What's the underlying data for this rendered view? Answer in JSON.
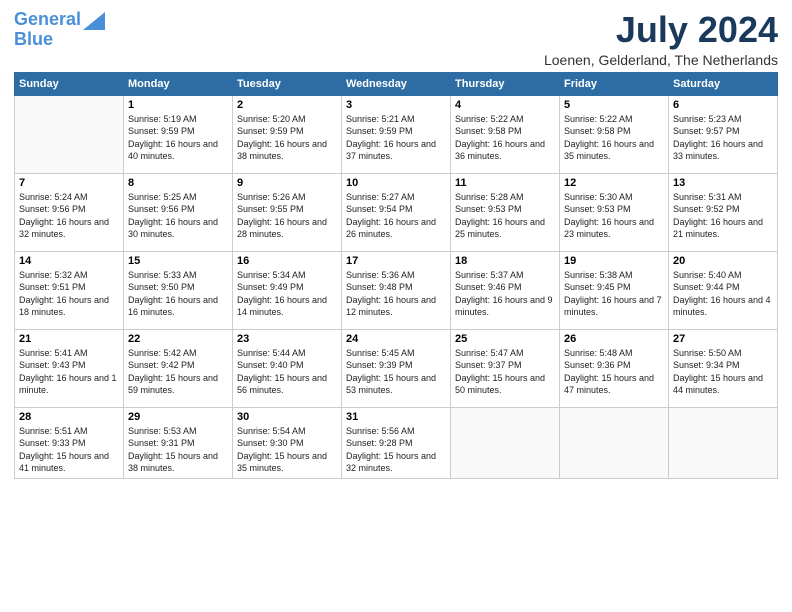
{
  "logo": {
    "line1": "General",
    "line2": "Blue"
  },
  "title": "July 2024",
  "location": "Loenen, Gelderland, The Netherlands",
  "days_of_week": [
    "Sunday",
    "Monday",
    "Tuesday",
    "Wednesday",
    "Thursday",
    "Friday",
    "Saturday"
  ],
  "weeks": [
    [
      {
        "num": "",
        "info": ""
      },
      {
        "num": "1",
        "info": "Sunrise: 5:19 AM\nSunset: 9:59 PM\nDaylight: 16 hours\nand 40 minutes."
      },
      {
        "num": "2",
        "info": "Sunrise: 5:20 AM\nSunset: 9:59 PM\nDaylight: 16 hours\nand 38 minutes."
      },
      {
        "num": "3",
        "info": "Sunrise: 5:21 AM\nSunset: 9:59 PM\nDaylight: 16 hours\nand 37 minutes."
      },
      {
        "num": "4",
        "info": "Sunrise: 5:22 AM\nSunset: 9:58 PM\nDaylight: 16 hours\nand 36 minutes."
      },
      {
        "num": "5",
        "info": "Sunrise: 5:22 AM\nSunset: 9:58 PM\nDaylight: 16 hours\nand 35 minutes."
      },
      {
        "num": "6",
        "info": "Sunrise: 5:23 AM\nSunset: 9:57 PM\nDaylight: 16 hours\nand 33 minutes."
      }
    ],
    [
      {
        "num": "7",
        "info": "Sunrise: 5:24 AM\nSunset: 9:56 PM\nDaylight: 16 hours\nand 32 minutes."
      },
      {
        "num": "8",
        "info": "Sunrise: 5:25 AM\nSunset: 9:56 PM\nDaylight: 16 hours\nand 30 minutes."
      },
      {
        "num": "9",
        "info": "Sunrise: 5:26 AM\nSunset: 9:55 PM\nDaylight: 16 hours\nand 28 minutes."
      },
      {
        "num": "10",
        "info": "Sunrise: 5:27 AM\nSunset: 9:54 PM\nDaylight: 16 hours\nand 26 minutes."
      },
      {
        "num": "11",
        "info": "Sunrise: 5:28 AM\nSunset: 9:53 PM\nDaylight: 16 hours\nand 25 minutes."
      },
      {
        "num": "12",
        "info": "Sunrise: 5:30 AM\nSunset: 9:53 PM\nDaylight: 16 hours\nand 23 minutes."
      },
      {
        "num": "13",
        "info": "Sunrise: 5:31 AM\nSunset: 9:52 PM\nDaylight: 16 hours\nand 21 minutes."
      }
    ],
    [
      {
        "num": "14",
        "info": "Sunrise: 5:32 AM\nSunset: 9:51 PM\nDaylight: 16 hours\nand 18 minutes."
      },
      {
        "num": "15",
        "info": "Sunrise: 5:33 AM\nSunset: 9:50 PM\nDaylight: 16 hours\nand 16 minutes."
      },
      {
        "num": "16",
        "info": "Sunrise: 5:34 AM\nSunset: 9:49 PM\nDaylight: 16 hours\nand 14 minutes."
      },
      {
        "num": "17",
        "info": "Sunrise: 5:36 AM\nSunset: 9:48 PM\nDaylight: 16 hours\nand 12 minutes."
      },
      {
        "num": "18",
        "info": "Sunrise: 5:37 AM\nSunset: 9:46 PM\nDaylight: 16 hours\nand 9 minutes."
      },
      {
        "num": "19",
        "info": "Sunrise: 5:38 AM\nSunset: 9:45 PM\nDaylight: 16 hours\nand 7 minutes."
      },
      {
        "num": "20",
        "info": "Sunrise: 5:40 AM\nSunset: 9:44 PM\nDaylight: 16 hours\nand 4 minutes."
      }
    ],
    [
      {
        "num": "21",
        "info": "Sunrise: 5:41 AM\nSunset: 9:43 PM\nDaylight: 16 hours\nand 1 minute."
      },
      {
        "num": "22",
        "info": "Sunrise: 5:42 AM\nSunset: 9:42 PM\nDaylight: 15 hours\nand 59 minutes."
      },
      {
        "num": "23",
        "info": "Sunrise: 5:44 AM\nSunset: 9:40 PM\nDaylight: 15 hours\nand 56 minutes."
      },
      {
        "num": "24",
        "info": "Sunrise: 5:45 AM\nSunset: 9:39 PM\nDaylight: 15 hours\nand 53 minutes."
      },
      {
        "num": "25",
        "info": "Sunrise: 5:47 AM\nSunset: 9:37 PM\nDaylight: 15 hours\nand 50 minutes."
      },
      {
        "num": "26",
        "info": "Sunrise: 5:48 AM\nSunset: 9:36 PM\nDaylight: 15 hours\nand 47 minutes."
      },
      {
        "num": "27",
        "info": "Sunrise: 5:50 AM\nSunset: 9:34 PM\nDaylight: 15 hours\nand 44 minutes."
      }
    ],
    [
      {
        "num": "28",
        "info": "Sunrise: 5:51 AM\nSunset: 9:33 PM\nDaylight: 15 hours\nand 41 minutes."
      },
      {
        "num": "29",
        "info": "Sunrise: 5:53 AM\nSunset: 9:31 PM\nDaylight: 15 hours\nand 38 minutes."
      },
      {
        "num": "30",
        "info": "Sunrise: 5:54 AM\nSunset: 9:30 PM\nDaylight: 15 hours\nand 35 minutes."
      },
      {
        "num": "31",
        "info": "Sunrise: 5:56 AM\nSunset: 9:28 PM\nDaylight: 15 hours\nand 32 minutes."
      },
      {
        "num": "",
        "info": ""
      },
      {
        "num": "",
        "info": ""
      },
      {
        "num": "",
        "info": ""
      }
    ]
  ]
}
